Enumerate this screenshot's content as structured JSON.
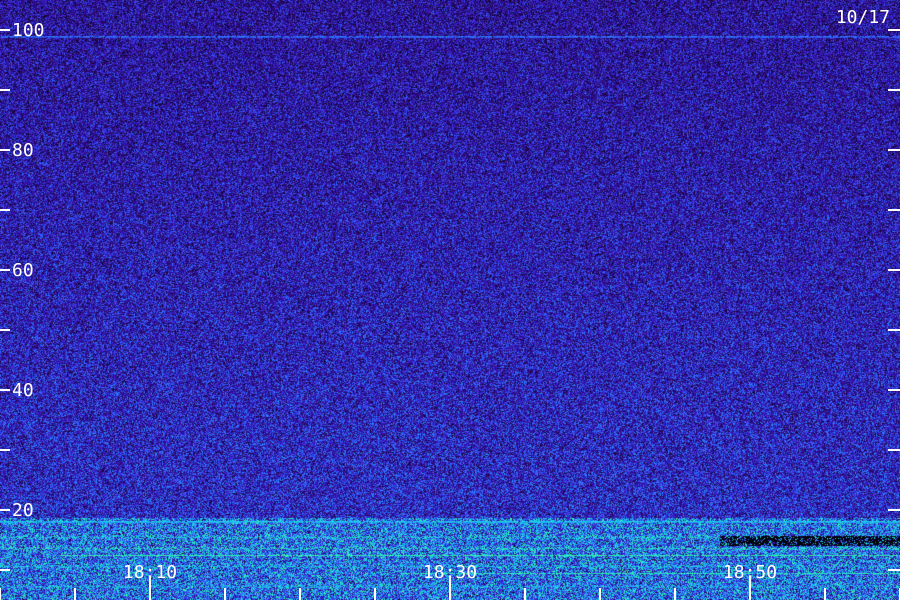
{
  "chart_data": {
    "type": "heatmap",
    "date_label": "10/17",
    "y_ticks": [
      100,
      80,
      60,
      40,
      20
    ],
    "ylim": [
      10,
      105
    ],
    "x_ticks": [
      "18:10",
      "18:30",
      "18:50"
    ],
    "xlim_minutes": [
      18.0,
      18.833
    ],
    "colormap": [
      "#000000",
      "#2a0a6e",
      "#3a18c8",
      "#2f6cff",
      "#19d3e8",
      "#3dff9a"
    ],
    "band_low_freq": 20
  }
}
